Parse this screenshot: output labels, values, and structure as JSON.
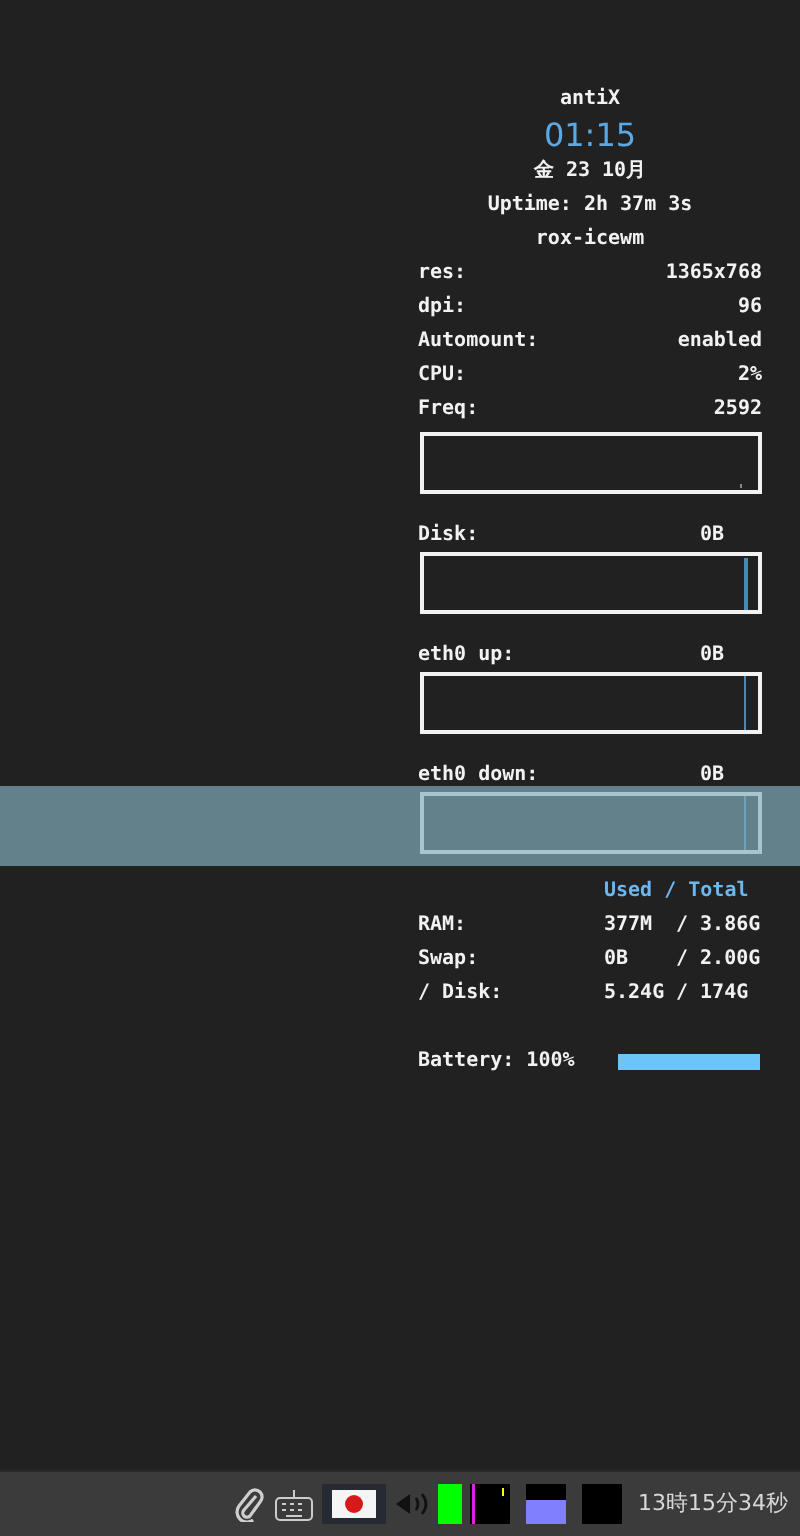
{
  "conky": {
    "distro": "antiX",
    "clock": "01:15",
    "date": "金 23 10月",
    "uptime": "Uptime: 2h 37m 3s",
    "session": "rox-icewm",
    "info": [
      {
        "label": "res:",
        "value": "1365x768"
      },
      {
        "label": "dpi:",
        "value": "96"
      },
      {
        "label": "Automount:",
        "value": "enabled"
      },
      {
        "label": "CPU:",
        "value": "2%"
      },
      {
        "label": "Freq:",
        "value": "2592"
      }
    ],
    "graphs": [
      {
        "kind": "plain"
      },
      {
        "kind": "labeled",
        "label": "Disk:",
        "value": "0B"
      },
      {
        "kind": "labeled",
        "label": "eth0 up:",
        "value": "0B"
      },
      {
        "kind": "labeled",
        "label": "eth0 down:",
        "value": "0B"
      }
    ],
    "memory": {
      "heading": "Used / Total",
      "rows": [
        {
          "label": "RAM:",
          "used": "377M",
          "total": "/ 3.86G"
        },
        {
          "label": "Swap:",
          "used": "0B",
          "total": "/ 2.00G"
        },
        {
          "label": "/ Disk:",
          "used": "5.24G",
          "total": "/ 174G"
        }
      ]
    },
    "battery": {
      "text": "Battery: 100%",
      "level": 1.0
    }
  },
  "taskbar": {
    "clock": "13時15分34秒"
  }
}
